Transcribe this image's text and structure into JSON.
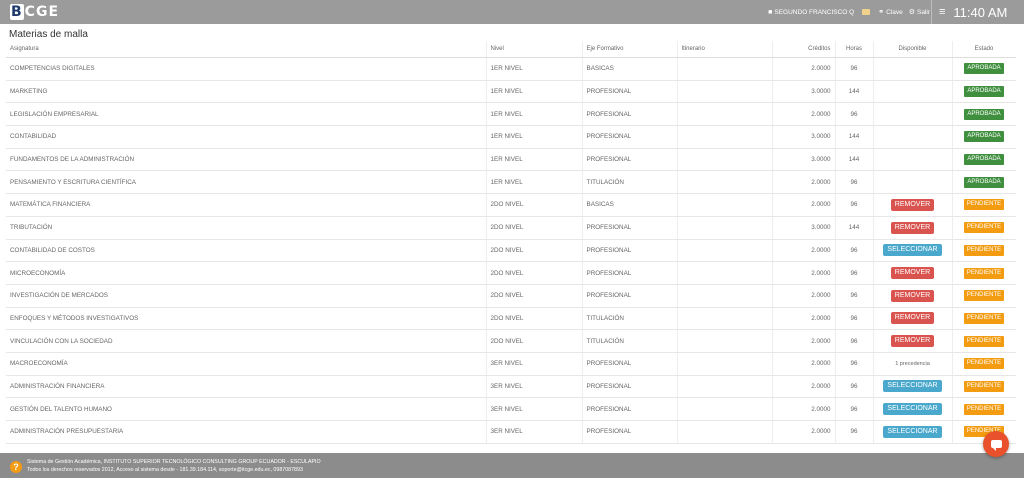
{
  "header": {
    "logo_text": "CGE",
    "logo_letter": "B",
    "user_icon": "user-icon",
    "user_name": "SEGUNDO FRANCISCO Q",
    "mail_icon": "mail-icon",
    "clave_label": "Clave",
    "clave_icon": "key-icon",
    "salir_label": "Salir",
    "salir_icon": "gear-icon",
    "menu_icon": "≡",
    "time": "11:40 AM"
  },
  "page": {
    "title": "Materias de malla"
  },
  "table": {
    "headers": {
      "asignatura": "Asignatura",
      "nivel": "Nivel",
      "eje": "Eje Formativo",
      "itinerario": "Itinerario",
      "creditos": "Créditos",
      "horas": "Horas",
      "disponible": "Disponible",
      "estado": "Estado"
    },
    "rows": [
      {
        "asignatura": "COMPETENCIAS DIGITALES",
        "nivel": "1ER NIVEL",
        "eje": "BASICAS",
        "itinerario": "",
        "creditos": "2.0000",
        "horas": "96",
        "disponible": "",
        "estado": "APROBADA"
      },
      {
        "asignatura": "MARKETING",
        "nivel": "1ER NIVEL",
        "eje": "PROFESIONAL",
        "itinerario": "",
        "creditos": "3.0000",
        "horas": "144",
        "disponible": "",
        "estado": "APROBADA"
      },
      {
        "asignatura": "LEGISLACIÓN EMPRESARIAL",
        "nivel": "1ER NIVEL",
        "eje": "PROFESIONAL",
        "itinerario": "",
        "creditos": "2.0000",
        "horas": "96",
        "disponible": "",
        "estado": "APROBADA"
      },
      {
        "asignatura": "CONTABILIDAD",
        "nivel": "1ER NIVEL",
        "eje": "PROFESIONAL",
        "itinerario": "",
        "creditos": "3.0000",
        "horas": "144",
        "disponible": "",
        "estado": "APROBADA"
      },
      {
        "asignatura": "FUNDAMENTOS DE LA ADMINISTRACIÓN",
        "nivel": "1ER NIVEL",
        "eje": "PROFESIONAL",
        "itinerario": "",
        "creditos": "3.0000",
        "horas": "144",
        "disponible": "",
        "estado": "APROBADA"
      },
      {
        "asignatura": "PENSAMIENTO Y ESCRITURA CIENTÍFICA",
        "nivel": "1ER NIVEL",
        "eje": "TITULACIÓN",
        "itinerario": "",
        "creditos": "2.0000",
        "horas": "96",
        "disponible": "",
        "estado": "APROBADA"
      },
      {
        "asignatura": "MATEMÁTICA FINANCIERA",
        "nivel": "2DO NIVEL",
        "eje": "BASICAS",
        "itinerario": "",
        "creditos": "2.0000",
        "horas": "96",
        "disponible": "REMOVER",
        "estado": "PENDIENTE"
      },
      {
        "asignatura": "TRIBUTACIÓN",
        "nivel": "2DO NIVEL",
        "eje": "PROFESIONAL",
        "itinerario": "",
        "creditos": "3.0000",
        "horas": "144",
        "disponible": "REMOVER",
        "estado": "PENDIENTE"
      },
      {
        "asignatura": "CONTABILIDAD DE COSTOS",
        "nivel": "2DO NIVEL",
        "eje": "PROFESIONAL",
        "itinerario": "",
        "creditos": "2.0000",
        "horas": "96",
        "disponible": "SELECCIONAR",
        "estado": "PENDIENTE"
      },
      {
        "asignatura": "MICROECONOMÍA",
        "nivel": "2DO NIVEL",
        "eje": "PROFESIONAL",
        "itinerario": "",
        "creditos": "2.0000",
        "horas": "96",
        "disponible": "REMOVER",
        "estado": "PENDIENTE"
      },
      {
        "asignatura": "INVESTIGACIÓN DE MERCADOS",
        "nivel": "2DO NIVEL",
        "eje": "PROFESIONAL",
        "itinerario": "",
        "creditos": "2.0000",
        "horas": "96",
        "disponible": "REMOVER",
        "estado": "PENDIENTE"
      },
      {
        "asignatura": "ENFOQUES Y MÉTODOS INVESTIGATIVOS",
        "nivel": "2DO NIVEL",
        "eje": "TITULACIÓN",
        "itinerario": "",
        "creditos": "2.0000",
        "horas": "96",
        "disponible": "REMOVER",
        "estado": "PENDIENTE"
      },
      {
        "asignatura": "VINCULACIÓN CON LA SOCIEDAD",
        "nivel": "2DO NIVEL",
        "eje": "TITULACIÓN",
        "itinerario": "",
        "creditos": "2.0000",
        "horas": "96",
        "disponible": "REMOVER",
        "estado": "PENDIENTE"
      },
      {
        "asignatura": "MACROECONOMÍA",
        "nivel": "3ER NIVEL",
        "eje": "PROFESIONAL",
        "itinerario": "",
        "creditos": "2.0000",
        "horas": "96",
        "disponible": "1 precedencia",
        "estado": "PENDIENTE"
      },
      {
        "asignatura": "ADMINISTRACIÓN FINANCIERA",
        "nivel": "3ER NIVEL",
        "eje": "PROFESIONAL",
        "itinerario": "",
        "creditos": "2.0000",
        "horas": "96",
        "disponible": "SELECCIONAR",
        "estado": "PENDIENTE"
      },
      {
        "asignatura": "GESTIÓN DEL TALENTO HUMANO",
        "nivel": "3ER NIVEL",
        "eje": "PROFESIONAL",
        "itinerario": "",
        "creditos": "2.0000",
        "horas": "96",
        "disponible": "SELECCIONAR",
        "estado": "PENDIENTE"
      },
      {
        "asignatura": "ADMINISTRACIÓN PRESUPUESTARIA",
        "nivel": "3ER NIVEL",
        "eje": "PROFESIONAL",
        "itinerario": "",
        "creditos": "2.0000",
        "horas": "96",
        "disponible": "SELECCIONAR",
        "estado": "PENDIENTE"
      }
    ]
  },
  "footer": {
    "help_icon": "?",
    "line1": "Sistema de Gestión Académica, INSTITUTO SUPERIOR TECNOLÓGICO CONSULTING GROUP ECUADOR - ESCULAPIO",
    "line2": "Todos los derechos reservados 2012, Acceso al sistema desde - 181.39.184.114, soporte@itcge.edu.ec, 0987087893"
  },
  "chat": {
    "icon": "chat-icon"
  },
  "colors": {
    "topbar": "#9b9b9b",
    "aprobada": "#3f8f3f",
    "pendiente": "#f39c12",
    "remover": "#d9534f",
    "seleccionar": "#4aa8cc",
    "chat": "#e8512b"
  }
}
